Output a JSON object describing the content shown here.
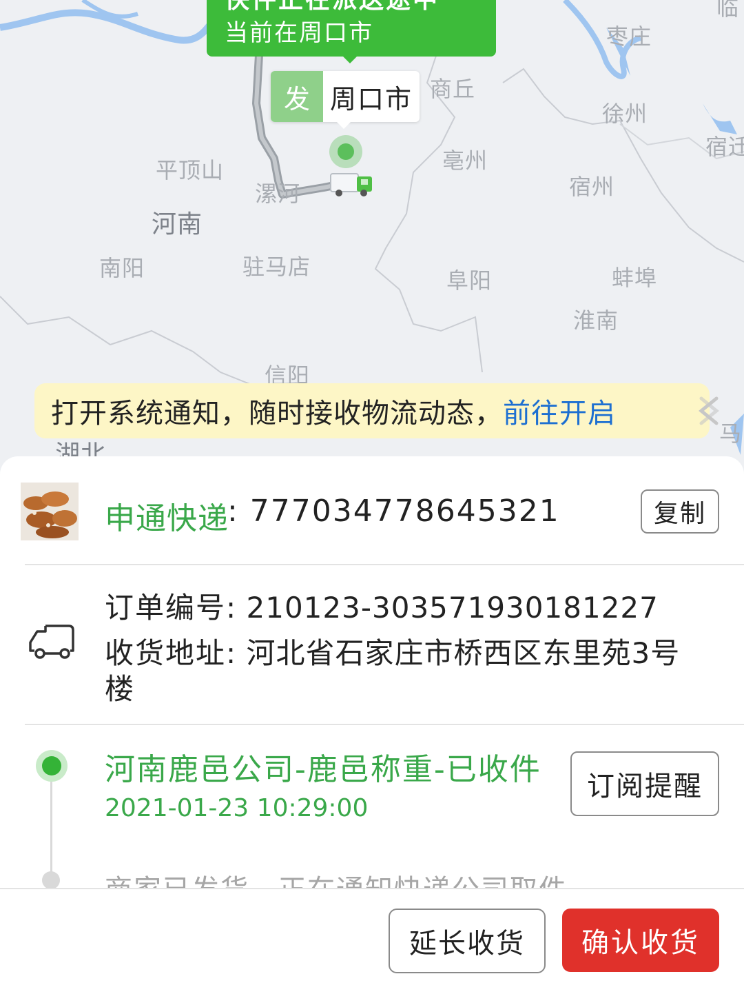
{
  "map": {
    "callout": {
      "title": "快件正在派送途中",
      "current_location": "当前在周口市"
    },
    "origin_tag": {
      "badge": "发",
      "city": "周口市"
    },
    "labels": {
      "zaozhuang": "枣庄",
      "shangqiu": "商丘",
      "xuzhou": "徐州",
      "suqian": "宿迁",
      "pingdingshan": "平顶山",
      "luohe": "漯河",
      "bozhou": "亳州",
      "suzhou": "宿州",
      "henan": "河南",
      "nanyang": "南阳",
      "zhumadian": "驻马店",
      "fuyang": "阜阳",
      "bengbu": "蚌埠",
      "huainan": "淮南",
      "xinyang": "信阳",
      "hubei": "湖北",
      "ma": "马",
      "heze": "临"
    }
  },
  "notice": {
    "message": "打开系统通知，随时接收物流动态，",
    "link": "前往开启"
  },
  "courier": {
    "name": "申通快递",
    "tracking_label": ": 777034778645321",
    "copy_label": "复制"
  },
  "order": {
    "number_label": "订单编号",
    "number_value": ": 210123-303571930181227",
    "address_label": "收货地址",
    "address_value": ": 河北省石家庄市桥西区东里苑3号",
    "address_value_cont": "楼"
  },
  "status": {
    "title": "河南鹿邑公司-鹿邑称重-已收件",
    "time": "2021-01-23 10:29:00",
    "subscribe_label": "订阅提醒",
    "previous_event": "商家已发货，正在通知快递公司取件"
  },
  "actions": {
    "extend_label": "延长收货",
    "confirm_label": "确认收货"
  },
  "colors": {
    "green": "#3dbb3a",
    "status_green": "#3aa84a",
    "confirm_red": "#e0312b",
    "link_blue": "#1d6fd1",
    "notice_bg": "#fdf6c6"
  }
}
